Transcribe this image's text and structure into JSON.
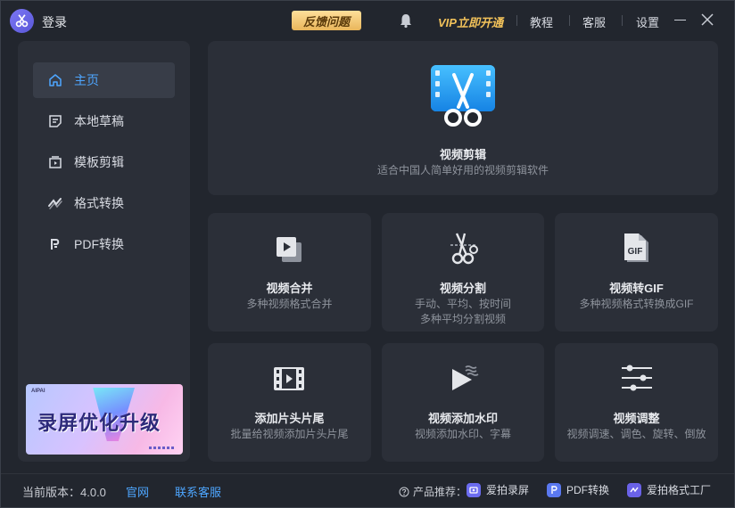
{
  "titlebar": {
    "login": "登录",
    "feedback": "反馈问题",
    "vip": "VIP立即开通",
    "tutorial": "教程",
    "service": "客服",
    "settings": "设置"
  },
  "sidebar": {
    "items": [
      {
        "label": "主页",
        "icon": "home-icon",
        "active": true
      },
      {
        "label": "本地草稿",
        "icon": "draft-icon"
      },
      {
        "label": "模板剪辑",
        "icon": "template-icon"
      },
      {
        "label": "格式转换",
        "icon": "convert-icon"
      },
      {
        "label": "PDF转换",
        "icon": "pdf-icon"
      }
    ],
    "banner": {
      "text": "录屏优化升级"
    }
  },
  "main": {
    "hero": {
      "title": "视频剪辑",
      "desc": "适合中国人简单好用的视频剪辑软件",
      "icon": "scissors-film-icon"
    },
    "tools": [
      {
        "title": "视频合并",
        "desc": "多种视频格式合并",
        "icon": "merge-icon"
      },
      {
        "title": "视频分割",
        "desc": "手动、平均、按时间",
        "desc2": "多种平均分割视频",
        "icon": "scissors-icon"
      },
      {
        "title": "视频转GIF",
        "desc": "多种视频格式转换成GIF",
        "icon": "gif-icon"
      },
      {
        "title": "添加片头片尾",
        "desc": "批量给视频添加片头片尾",
        "icon": "film-strip-icon"
      },
      {
        "title": "视频添加水印",
        "desc": "视频添加水印、字幕",
        "icon": "watermark-icon"
      },
      {
        "title": "视频调整",
        "desc": "视频调速、调色、旋转、倒放",
        "icon": "sliders-icon"
      }
    ]
  },
  "footer": {
    "version": "当前版本：4.0.0",
    "website": "官网",
    "contact": "联系客服",
    "recommend": "产品推荐：",
    "products": [
      {
        "label": "爱拍录屏",
        "color": "#6b6cf0"
      },
      {
        "label": "PDF转换",
        "color": "#5a78f0"
      },
      {
        "label": "爱拍格式工厂",
        "color": "#6a62e8"
      }
    ]
  },
  "colors": {
    "accent": "#4ea6ff",
    "vip": "#f2c25a",
    "card": "#2b2f38",
    "background": "#22262e"
  }
}
